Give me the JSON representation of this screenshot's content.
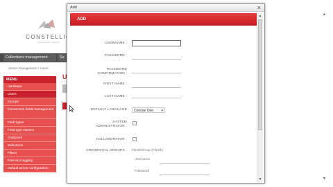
{
  "brand": {
    "name": "CONSTELLIO",
    "tagline": "enterprise search"
  },
  "topnav": {
    "items": [
      {
        "label": "Collections management"
      },
      {
        "label": "Se"
      }
    ]
  },
  "breadcrumb": "Server management > Users",
  "sidebar": {
    "header": "MENU",
    "items": [
      {
        "label": "Hardware"
      },
      {
        "label": "Users"
      },
      {
        "label": "Groups"
      },
      {
        "label": "Connectors fields management"
      },
      {
        "label": "Field types"
      },
      {
        "label": "Field type classes"
      },
      {
        "label": "Analyzers"
      },
      {
        "label": "Selections"
      },
      {
        "label": "Filters"
      },
      {
        "label": "Free text tagging"
      },
      {
        "label": "Default server configuration"
      }
    ]
  },
  "background": {
    "page_title": "U"
  },
  "modal": {
    "window_title": "Add",
    "close_glyph": "×",
    "form_header": "ADD",
    "fields": {
      "username": {
        "label": "USERNAME :",
        "value": ""
      },
      "password": {
        "label": "PASSWORD :",
        "value": ""
      },
      "password_confirmation": {
        "label": "PASSWORD CONFIRMATION :",
        "value": ""
      },
      "first_name": {
        "label": "FIRST NAME :",
        "value": ""
      },
      "last_name": {
        "label": "LAST NAME :",
        "value": ""
      },
      "default_language": {
        "label": "DEFAULT LANGUAGE",
        "value": "Choose One"
      },
      "system_administrator": {
        "label": "SYSTEM ADMINISTRATOR :",
        "checked": false
      },
      "collaborator": {
        "label": "COLLABORATOR :",
        "checked": false
      },
      "credential_groups": {
        "label": "CREDENTIAL GROUPS :",
        "group_name": "FileShGroup (FileSh)",
        "username_label": "Username",
        "password_label": "Password"
      }
    }
  },
  "colors": {
    "accent_red": "#c8212c",
    "sidebar_item": "#e84f4f",
    "nav_dark": "#4a4a4a"
  }
}
